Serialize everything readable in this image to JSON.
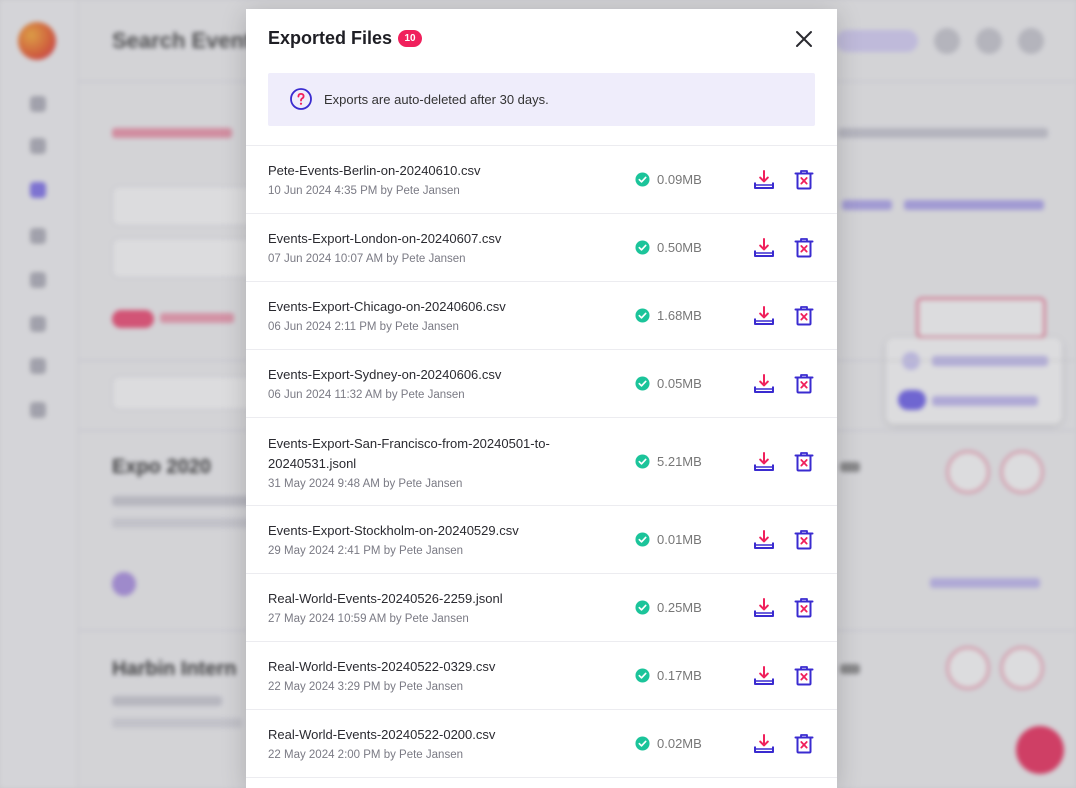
{
  "modal": {
    "title": "Exported Files",
    "count": "10",
    "notice": "Exports are auto-deleted after 30 days."
  },
  "files": [
    {
      "name": "Pete-Events-Berlin-on-20240610.csv",
      "meta": "10 Jun 2024 4:35 PM by Pete Jansen",
      "size": "0.09MB"
    },
    {
      "name": "Events-Export-London-on-20240607.csv",
      "meta": "07 Jun 2024 10:07 AM by Pete Jansen",
      "size": "0.50MB"
    },
    {
      "name": "Events-Export-Chicago-on-20240606.csv",
      "meta": "06 Jun 2024 2:11 PM by Pete Jansen",
      "size": "1.68MB"
    },
    {
      "name": "Events-Export-Sydney-on-20240606.csv",
      "meta": "06 Jun 2024 11:32 AM by Pete Jansen",
      "size": "0.05MB"
    },
    {
      "name": "Events-Export-San-Francisco-from-20240501-to-20240531.jsonl",
      "meta": "31 May 2024 9:48 AM by Pete Jansen",
      "size": "5.21MB"
    },
    {
      "name": "Events-Export-Stockholm-on-20240529.csv",
      "meta": "29 May 2024 2:41 PM by Pete Jansen",
      "size": "0.01MB"
    },
    {
      "name": "Real-World-Events-20240526-2259.jsonl",
      "meta": "27 May 2024 10:59 AM by Pete Jansen",
      "size": "0.25MB"
    },
    {
      "name": "Real-World-Events-20240522-0329.csv",
      "meta": "22 May 2024 3:29 PM by Pete Jansen",
      "size": "0.17MB"
    },
    {
      "name": "Real-World-Events-20240522-0200.csv",
      "meta": "22 May 2024 2:00 PM by Pete Jansen",
      "size": "0.02MB"
    }
  ],
  "background": {
    "page_title": "Search Events",
    "card_titles": [
      "Expo 2020",
      "Harbin Intern"
    ]
  },
  "icons": {
    "close": "close-icon",
    "notice": "question-circle-icon",
    "status": "check-circle-icon",
    "download": "download-icon",
    "delete": "trash-icon"
  },
  "colors": {
    "accent": "#3a2bd0",
    "brand_pink": "#f0205c",
    "success": "#1bc49a",
    "notice_bg": "#efedfb"
  }
}
